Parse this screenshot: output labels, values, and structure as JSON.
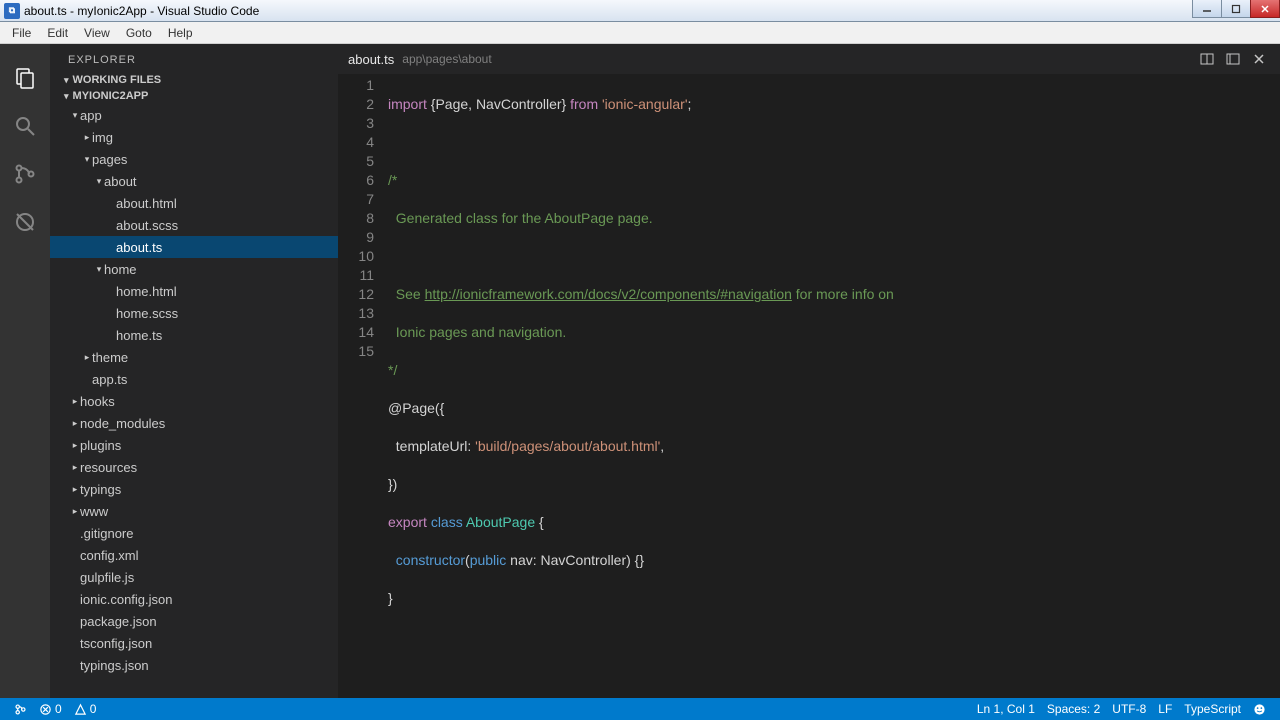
{
  "window": {
    "title": "about.ts - myIonic2App - Visual Studio Code"
  },
  "menu": {
    "items": [
      "File",
      "Edit",
      "View",
      "Goto",
      "Help"
    ]
  },
  "sidebar": {
    "header": "EXPLORER",
    "sections": {
      "working": "WORKING FILES",
      "project": "MYIONIC2APP"
    },
    "tree": [
      {
        "label": "app",
        "depth": 0,
        "expand": "▾"
      },
      {
        "label": "img",
        "depth": 1,
        "expand": "▸"
      },
      {
        "label": "pages",
        "depth": 1,
        "expand": "▾"
      },
      {
        "label": "about",
        "depth": 2,
        "expand": "▾"
      },
      {
        "label": "about.html",
        "depth": 3,
        "expand": ""
      },
      {
        "label": "about.scss",
        "depth": 3,
        "expand": ""
      },
      {
        "label": "about.ts",
        "depth": 3,
        "expand": "",
        "selected": true
      },
      {
        "label": "home",
        "depth": 2,
        "expand": "▾"
      },
      {
        "label": "home.html",
        "depth": 3,
        "expand": ""
      },
      {
        "label": "home.scss",
        "depth": 3,
        "expand": ""
      },
      {
        "label": "home.ts",
        "depth": 3,
        "expand": ""
      },
      {
        "label": "theme",
        "depth": 1,
        "expand": "▸"
      },
      {
        "label": "app.ts",
        "depth": 1,
        "expand": ""
      },
      {
        "label": "hooks",
        "depth": 0,
        "expand": "▸"
      },
      {
        "label": "node_modules",
        "depth": 0,
        "expand": "▸"
      },
      {
        "label": "plugins",
        "depth": 0,
        "expand": "▸"
      },
      {
        "label": "resources",
        "depth": 0,
        "expand": "▸"
      },
      {
        "label": "typings",
        "depth": 0,
        "expand": "▸"
      },
      {
        "label": "www",
        "depth": 0,
        "expand": "▸"
      },
      {
        "label": ".gitignore",
        "depth": 0,
        "expand": ""
      },
      {
        "label": "config.xml",
        "depth": 0,
        "expand": ""
      },
      {
        "label": "gulpfile.js",
        "depth": 0,
        "expand": ""
      },
      {
        "label": "ionic.config.json",
        "depth": 0,
        "expand": ""
      },
      {
        "label": "package.json",
        "depth": 0,
        "expand": ""
      },
      {
        "label": "tsconfig.json",
        "depth": 0,
        "expand": ""
      },
      {
        "label": "typings.json",
        "depth": 0,
        "expand": ""
      }
    ]
  },
  "tab": {
    "name": "about.ts",
    "path": "app\\pages\\about"
  },
  "code": {
    "l1a": "import",
    "l1b": " {Page, NavController} ",
    "l1c": "from",
    "l1d": " ",
    "l1e": "'ionic-angular'",
    "l1f": ";",
    "l3": "/*",
    "l4": "  Generated class for the AboutPage page.",
    "l5": "",
    "l6a": "  See ",
    "l6b": "http://ionicframework.com/docs/v2/components/#navigation",
    "l6c": " for more info on",
    "l7": "  Ionic pages and navigation.",
    "l8": "*/",
    "l9": "@Page({",
    "l10a": "  templateUrl: ",
    "l10b": "'build/pages/about/about.html'",
    "l10c": ",",
    "l11": "})",
    "l12a": "export",
    "l12b": " ",
    "l12c": "class",
    "l12d": " ",
    "l12e": "AboutPage",
    "l12f": " {",
    "l13a": "  ",
    "l13b": "constructor",
    "l13c": "(",
    "l13d": "public",
    "l13e": " nav: NavController) {}",
    "l14": "}"
  },
  "status": {
    "errors": "0",
    "warnings": "0",
    "cursor": "Ln 1, Col 1",
    "spaces": "Spaces: 2",
    "encoding": "UTF-8",
    "eol": "LF",
    "lang": "TypeScript"
  }
}
